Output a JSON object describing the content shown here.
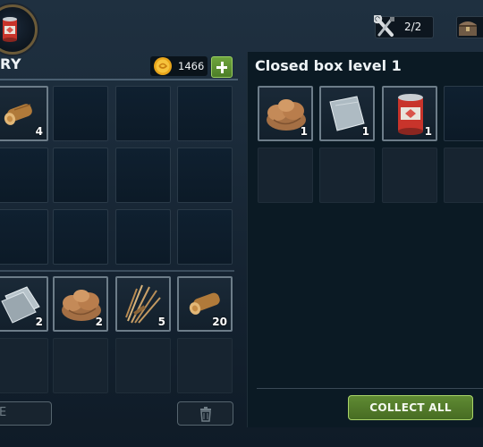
{
  "hud": {
    "avatar_icon": "food-can-icon",
    "tools_count": "2/2",
    "tools_icon": "wrench-screwdriver-icon",
    "chest_icon": "chest-icon"
  },
  "inventory": {
    "title": "RY",
    "coins": "1466",
    "coin_icon": "coin-icon",
    "add_coins_icon": "plus-icon",
    "top_slots": [
      {
        "item": "log-icon",
        "qty": "4"
      },
      {
        "item": "",
        "qty": ""
      },
      {
        "item": "",
        "qty": ""
      },
      {
        "item": "",
        "qty": ""
      },
      {
        "item": "",
        "qty": ""
      },
      {
        "item": "",
        "qty": ""
      },
      {
        "item": "",
        "qty": ""
      },
      {
        "item": "",
        "qty": ""
      },
      {
        "item": "",
        "qty": ""
      },
      {
        "item": "",
        "qty": ""
      },
      {
        "item": "",
        "qty": ""
      },
      {
        "item": "",
        "qty": ""
      }
    ],
    "bottom_slots": [
      {
        "item": "metal-sheet-icon",
        "qty": "2"
      },
      {
        "item": "clay-icon",
        "qty": "2"
      },
      {
        "item": "fiber-bundle-icon",
        "qty": "5"
      },
      {
        "item": "log-icon",
        "qty": "20"
      },
      {
        "item": "",
        "qty": ""
      },
      {
        "item": "",
        "qty": ""
      },
      {
        "item": "",
        "qty": ""
      },
      {
        "item": "",
        "qty": ""
      }
    ],
    "left_button_label": "E",
    "trash_icon": "trash-icon"
  },
  "box": {
    "title": "Closed box level 1",
    "slots": [
      {
        "item": "clay-icon",
        "qty": "1"
      },
      {
        "item": "metal-sheet-icon",
        "qty": "1"
      },
      {
        "item": "food-can-icon",
        "qty": "1"
      },
      {
        "item": "",
        "qty": ""
      },
      {
        "item": "",
        "qty": ""
      },
      {
        "item": "",
        "qty": ""
      },
      {
        "item": "",
        "qty": ""
      },
      {
        "item": "",
        "qty": ""
      }
    ],
    "collect_all_label": "COLLECT ALL"
  },
  "colors": {
    "accent_green": "#5f8a33",
    "can_red": "#c8342b",
    "wood": "#b07a3a"
  }
}
